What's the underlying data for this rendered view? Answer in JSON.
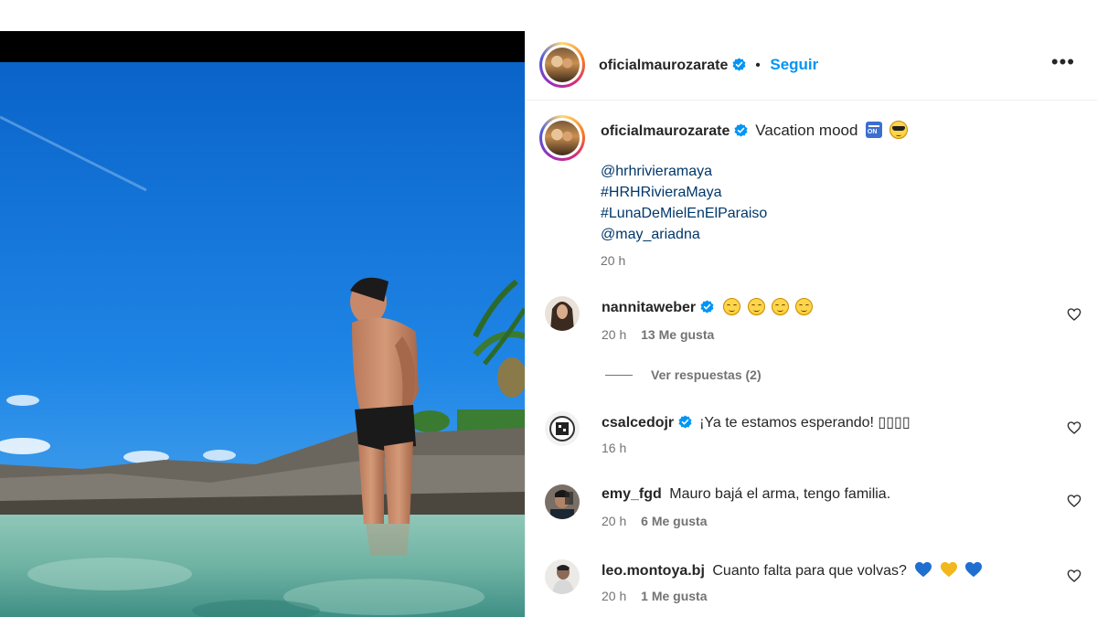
{
  "post": {
    "author": "oficialmaurozarate",
    "follow_label": "Seguir",
    "separator": "•",
    "more_label": "•••",
    "caption": "Vacation mood",
    "caption_links": [
      "@hrhrivieramaya",
      "#HRHRivieraMaya",
      "#LunaDeMielEnElParaiso",
      "@may_ariadna"
    ],
    "caption_time": "20 h"
  },
  "comments": [
    {
      "user": "nannitaweber",
      "verified": true,
      "text": "",
      "emoji": [
        "grinning-face",
        "grinning-face",
        "grinning-face",
        "grinning-face"
      ],
      "time": "20 h",
      "likes": "13 Me gusta"
    },
    {
      "user": "csalcedojr",
      "verified": true,
      "text": "¡Ya te estamos esperando! ▯▯▯▯",
      "time": "16 h",
      "likes": ""
    },
    {
      "user": "emy_fgd",
      "verified": false,
      "text": "Mauro bajá el arma, tengo familia.",
      "time": "20 h",
      "likes": "6 Me gusta"
    },
    {
      "user": "leo.montoya.bj",
      "verified": false,
      "text": "Cuanto falta para que volvas?",
      "emoji": [
        "blue-heart",
        "yellow-heart",
        "blue-heart"
      ],
      "time": "20 h",
      "likes": "1 Me gusta"
    }
  ],
  "view_replies": "Ver respuestas (2)",
  "colors": {
    "follow": "#0095f6",
    "link": "#00376b",
    "verified": "#0095f6",
    "secondary": "#737373"
  },
  "icons": [
    "verified-badge-icon",
    "more-options-icon",
    "heart-outline-icon",
    "on-arrow-emoji-icon",
    "sunglasses-emoji-icon"
  ]
}
